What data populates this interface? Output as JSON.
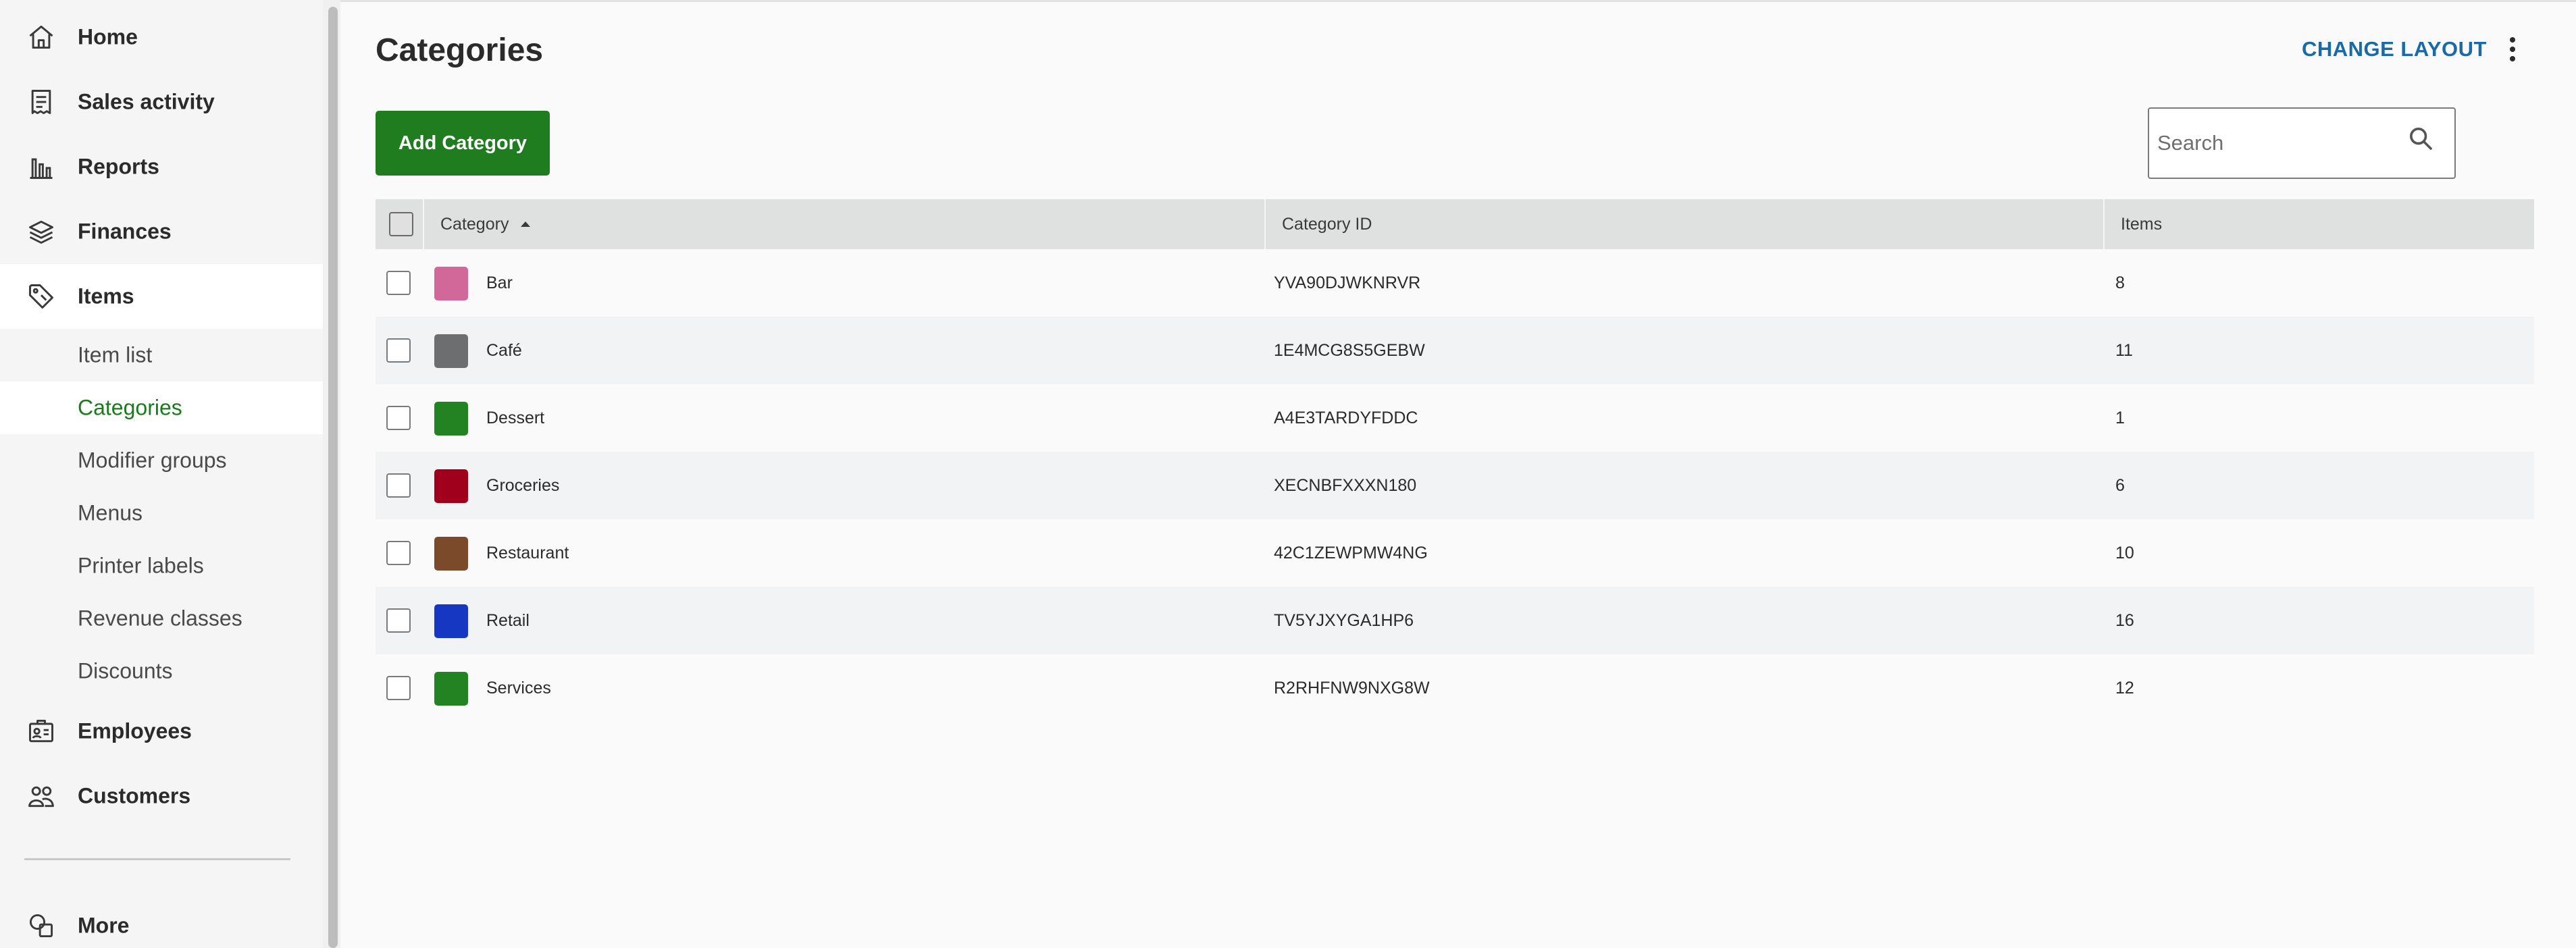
{
  "sidebar": {
    "nav": [
      {
        "label": "Home",
        "icon": "home-icon"
      },
      {
        "label": "Sales activity",
        "icon": "receipt-icon"
      },
      {
        "label": "Reports",
        "icon": "bar-chart-icon"
      },
      {
        "label": "Finances",
        "icon": "layers-icon"
      },
      {
        "label": "Items",
        "icon": "tag-icon"
      }
    ],
    "sub_items": [
      {
        "label": "Item list"
      },
      {
        "label": "Categories"
      },
      {
        "label": "Modifier groups"
      },
      {
        "label": "Menus"
      },
      {
        "label": "Printer labels"
      },
      {
        "label": "Revenue classes"
      },
      {
        "label": "Discounts"
      }
    ],
    "bottom_nav": [
      {
        "label": "Employees",
        "icon": "id-card-icon"
      },
      {
        "label": "Customers",
        "icon": "people-icon"
      },
      {
        "label": "More",
        "icon": "shapes-icon"
      }
    ]
  },
  "header": {
    "title": "Categories",
    "change_layout": "CHANGE LAYOUT"
  },
  "toolbar": {
    "add_label": "Add Category"
  },
  "search": {
    "placeholder": "Search",
    "value": ""
  },
  "table": {
    "columns": {
      "category": "Category",
      "category_id": "Category ID",
      "items": "Items"
    },
    "sort": {
      "column": "Category",
      "direction": "ascending"
    },
    "rows": [
      {
        "name": "Bar",
        "id": "YVA90DJWKNRVR",
        "items": "8",
        "color": "#d2679a"
      },
      {
        "name": "Café",
        "id": "1E4MCG8S5GEBW",
        "items": "11",
        "color": "#6d6e70"
      },
      {
        "name": "Dessert",
        "id": "A4E3TARDYFDDC",
        "items": "1",
        "color": "#238322"
      },
      {
        "name": "Groceries",
        "id": "XECNBFXXXN180",
        "items": "6",
        "color": "#a0001c"
      },
      {
        "name": "Restaurant",
        "id": "42C1ZEWPMW4NG",
        "items": "10",
        "color": "#7b4a2b"
      },
      {
        "name": "Retail",
        "id": "TV5YJXYGA1HP6",
        "items": "16",
        "color": "#1537c2"
      },
      {
        "name": "Services",
        "id": "R2RHFNW9NXG8W",
        "items": "12",
        "color": "#238322"
      }
    ]
  },
  "colors": {
    "accent_green": "#1f7d1f",
    "link_blue": "#1a6aa5",
    "active_sub_text": "#1b7a1d"
  }
}
